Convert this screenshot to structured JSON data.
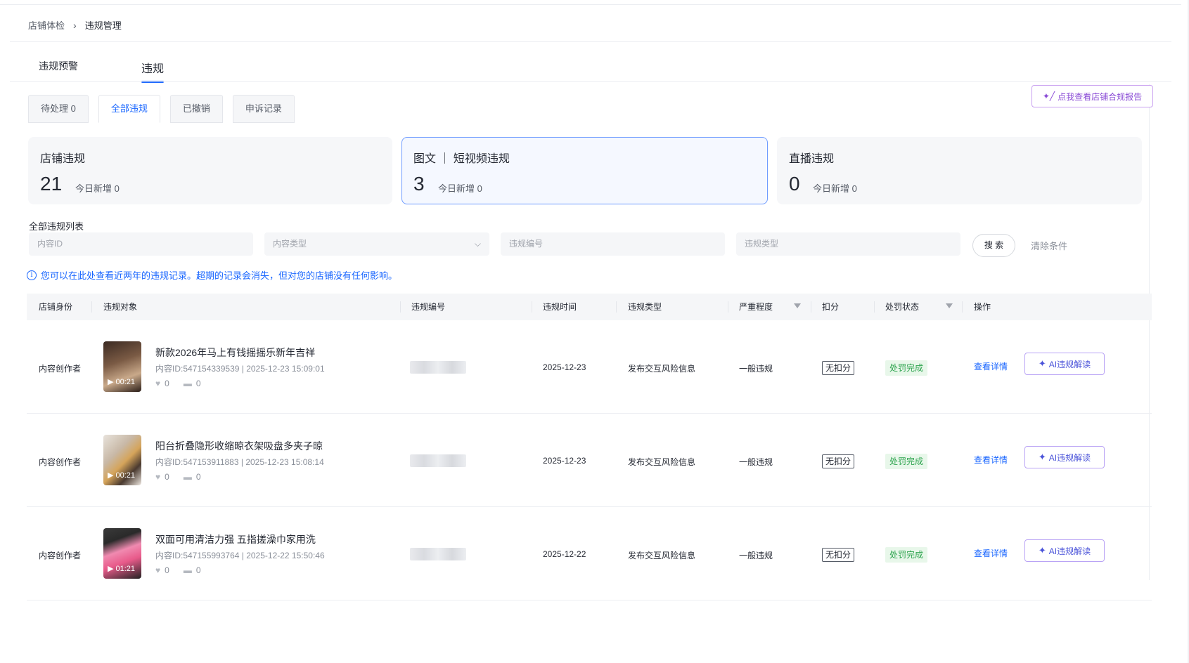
{
  "breadcrumb": {
    "parent": "店铺体检",
    "separator": "›",
    "current": "违规管理"
  },
  "main_tabs": [
    {
      "label": "违规预警"
    },
    {
      "label": "违规"
    }
  ],
  "sub_tabs": [
    {
      "label": "待处理 0"
    },
    {
      "label": "全部违规"
    },
    {
      "label": "已撤销"
    },
    {
      "label": "申诉记录"
    }
  ],
  "report_button": {
    "label": "点我查看店铺合规报告"
  },
  "stats": [
    {
      "title": "店铺违规",
      "count": "21",
      "new_today": "今日新增 0"
    },
    {
      "title": "图文 ｜ 短视频违规",
      "count": "3",
      "new_today": "今日新增 0"
    },
    {
      "title": "直播违规",
      "count": "0",
      "new_today": "今日新增 0"
    }
  ],
  "list_title": "全部违规列表",
  "filters": {
    "search_placeholder": "内容ID",
    "content_type_placeholder": "内容类型",
    "violation_no_placeholder": "违规编号",
    "violation_type_placeholder": "违规类型",
    "search_label": "搜 索",
    "clear_label": "清除条件"
  },
  "notice": "您可以在此处查看近两年的违规记录。超期的记录会消失，但对您的店铺没有任何影响。",
  "table": {
    "columns": [
      "店铺身份",
      "违规对象",
      "违规编号",
      "违规时间",
      "违规类型",
      "严重程度",
      "扣分",
      "处罚状态",
      "操作"
    ],
    "rows": [
      {
        "identity": "内容创作者",
        "title": "新款2026年马上有钱摇摇乐新年吉祥",
        "meta": "内容ID:547154339539 | 2025-12-23 15:09:01",
        "likes": "0",
        "comments": "0",
        "duration": "00:21",
        "date": "2025-12-23",
        "type": "发布交互风险信息",
        "severity": "一般违规",
        "deduct": "无扣分",
        "status": "处罚完成",
        "detail": "查看详情",
        "ai": "AI违规解读"
      },
      {
        "identity": "内容创作者",
        "title": "阳台折叠隐形收缩晾衣架吸盘多夹子晾",
        "meta": "内容ID:547153911883 | 2025-12-23 15:08:14",
        "likes": "0",
        "comments": "0",
        "duration": "00:21",
        "date": "2025-12-23",
        "type": "发布交互风险信息",
        "severity": "一般违规",
        "deduct": "无扣分",
        "status": "处罚完成",
        "detail": "查看详情",
        "ai": "AI违规解读"
      },
      {
        "identity": "内容创作者",
        "title": "双面可用清洁力强 五指搓澡巾家用洗",
        "meta": "内容ID:547155993764 | 2025-12-22 15:50:46",
        "likes": "0",
        "comments": "0",
        "duration": "01:21",
        "date": "2025-12-22",
        "type": "发布交互风险信息",
        "severity": "一般违规",
        "deduct": "无扣分",
        "status": "处罚完成",
        "detail": "查看详情",
        "ai": "AI违规解读"
      }
    ]
  },
  "colors": {
    "accent": "#1966ff",
    "success": "#2ea44f",
    "ai_purple": "#8a4bd6"
  }
}
